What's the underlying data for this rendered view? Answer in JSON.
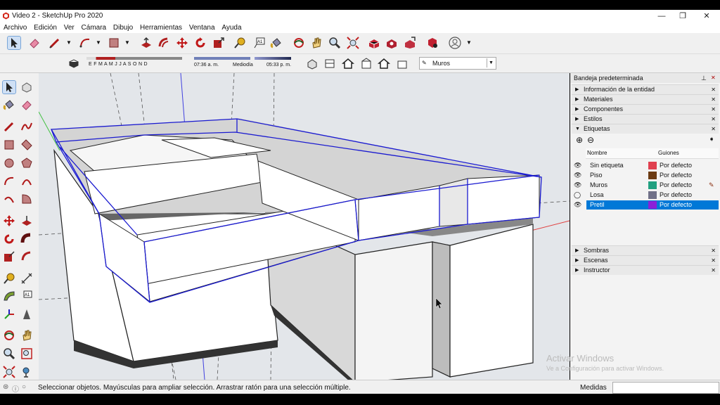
{
  "window": {
    "title": "Video 2 - SketchUp Pro 2020",
    "minimize": "—",
    "restore": "❐",
    "close": "✕"
  },
  "menu": [
    "Archivo",
    "Edición",
    "Ver",
    "Cámara",
    "Dibujo",
    "Herramientas",
    "Ventana",
    "Ayuda"
  ],
  "shadows": {
    "months": "E F M A M J J A S O N D",
    "time_start": "07:36 a. m.",
    "time_mid": "Mediodía",
    "time_end": "05:33 p. m."
  },
  "tag_dropdown": {
    "value": "Muros"
  },
  "tray": {
    "title": "Bandeja predeterminada",
    "panels_top": [
      {
        "label": "Información de la entidad"
      },
      {
        "label": "Materiales"
      },
      {
        "label": "Componentes"
      },
      {
        "label": "Estilos"
      },
      {
        "label": "Etiquetas"
      }
    ],
    "tags_header": {
      "name": "Nombre",
      "dashes": "Guiones"
    },
    "tags": [
      {
        "name": "Sin etiqueta",
        "color": "#e0404f",
        "dashes": "Por defecto",
        "visible": true
      },
      {
        "name": "Piso",
        "color": "#6b3a12",
        "dashes": "Por defecto",
        "visible": true
      },
      {
        "name": "Muros",
        "color": "#20a080",
        "dashes": "Por defecto",
        "visible": true
      },
      {
        "name": "Losa",
        "color": "#707088",
        "dashes": "Por defecto",
        "visible": false
      },
      {
        "name": "Pretil",
        "color": "#8a20d8",
        "dashes": "Por defecto",
        "visible": true
      }
    ],
    "panels_bottom": [
      {
        "label": "Sombras"
      },
      {
        "label": "Escenas"
      },
      {
        "label": "Instructor"
      }
    ]
  },
  "status": {
    "hint": "Seleccionar objetos. Mayúsculas para ampliar selección. Arrastrar ratón para una selección múltiple.",
    "measure_label": "Medidas"
  },
  "watermark": {
    "line1": "Activar Windows",
    "line2": "Ve a Configuración para activar Windows."
  },
  "colors": {
    "selection_blue": "#1a1ad0",
    "tag_selected_bg": "#0078d7"
  }
}
